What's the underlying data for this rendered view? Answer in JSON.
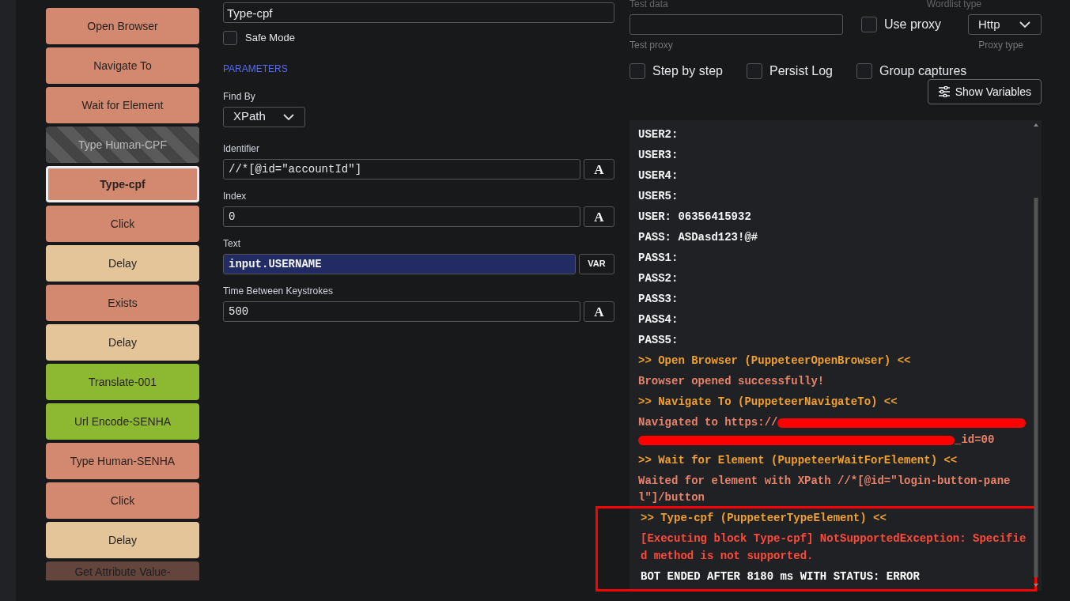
{
  "blocks": [
    {
      "label": "Open Browser",
      "kind": "action",
      "selected": false,
      "disabled": false
    },
    {
      "label": "Navigate To",
      "kind": "action",
      "selected": false,
      "disabled": false
    },
    {
      "label": "Wait for Element",
      "kind": "action",
      "selected": false,
      "disabled": false
    },
    {
      "label": "Type Human-CPF",
      "kind": "action",
      "selected": false,
      "disabled": true
    },
    {
      "label": "Type-cpf",
      "kind": "action",
      "selected": true,
      "disabled": false
    },
    {
      "label": "Click",
      "kind": "action",
      "selected": false,
      "disabled": false
    },
    {
      "label": "Delay",
      "kind": "delay",
      "selected": false,
      "disabled": false
    },
    {
      "label": "Exists",
      "kind": "action",
      "selected": false,
      "disabled": false
    },
    {
      "label": "Delay",
      "kind": "delay",
      "selected": false,
      "disabled": false
    },
    {
      "label": "Translate-001",
      "kind": "function",
      "selected": false,
      "disabled": false
    },
    {
      "label": "Url Encode-SENHA",
      "kind": "function",
      "selected": false,
      "disabled": false
    },
    {
      "label": "Type Human-SENHA",
      "kind": "action",
      "selected": false,
      "disabled": false
    },
    {
      "label": "Click",
      "kind": "action",
      "selected": false,
      "disabled": false
    },
    {
      "label": "Delay",
      "kind": "delay",
      "selected": false,
      "disabled": false
    },
    {
      "label": "Get Attribute Value-",
      "kind": "action",
      "selected": false,
      "disabled": false
    }
  ],
  "block_settings": {
    "name": "Type-cpf",
    "safe_mode": {
      "label": "Safe Mode",
      "checked": false
    },
    "section": "PARAMETERS",
    "find_by": {
      "label": "Find By",
      "value": "XPath"
    },
    "params": [
      {
        "label": "Identifier",
        "value": "//*[@id=\"accountId\"]",
        "mode": "A",
        "kind": "fixed"
      },
      {
        "label": "Index",
        "value": "0",
        "mode": "A",
        "kind": "fixed"
      },
      {
        "label": "Text",
        "value": "input.USERNAME",
        "mode": "VAR",
        "kind": "variable"
      },
      {
        "label": "Time Between Keystrokes",
        "value": "500",
        "mode": "A",
        "kind": "fixed"
      }
    ]
  },
  "debugger": {
    "test_data_label": "Test data",
    "wordlist_type_label": "Wordlist type",
    "test_proxy_label": "Test proxy",
    "use_proxy": {
      "label": "Use proxy",
      "checked": false
    },
    "proxy_type": {
      "value": "Http",
      "label": "Proxy type"
    },
    "options": [
      {
        "label": "Step by step",
        "checked": false
      },
      {
        "label": "Persist Log",
        "checked": false
      },
      {
        "label": "Group captures",
        "checked": false
      }
    ],
    "show_variables": "Show Variables",
    "log": [
      {
        "kind": "variable",
        "text": "USER2:"
      },
      {
        "kind": "variable",
        "text": "USER3:"
      },
      {
        "kind": "variable",
        "text": "USER4:"
      },
      {
        "kind": "variable",
        "text": "USER5:"
      },
      {
        "kind": "variable",
        "text": "USER: 06356415932"
      },
      {
        "kind": "variable",
        "text": "PASS: ASDasd123!@#"
      },
      {
        "kind": "variable",
        "text": "PASS1:"
      },
      {
        "kind": "variable",
        "text": "PASS2:"
      },
      {
        "kind": "variable",
        "text": "PASS3:"
      },
      {
        "kind": "variable",
        "text": "PASS4:"
      },
      {
        "kind": "variable",
        "text": "PASS5:"
      },
      {
        "kind": "header",
        "text": ">> Open Browser (PuppeteerOpenBrowser) <<"
      },
      {
        "kind": "info",
        "text": "Browser opened successfully!"
      },
      {
        "kind": "header",
        "text": ">> Navigate To (PuppeteerNavigateTo) <<"
      },
      {
        "kind": "redacted",
        "text": "Navigated to https://",
        "tail": "_id=00"
      },
      {
        "kind": "header",
        "text": ">> Wait for Element (PuppeteerWaitForElement) <<"
      },
      {
        "kind": "info",
        "text": "Waited for element with XPath //*[@id=\"login-button-panel\"]/button"
      },
      {
        "kind": "header",
        "text": ">> Type-cpf (PuppeteerTypeElement) <<",
        "highlighted": true
      },
      {
        "kind": "error",
        "text": "[Executing block Type-cpf] NotSupportedException: Specified method is not supported.",
        "highlighted": true
      },
      {
        "kind": "end",
        "text": "BOT ENDED AFTER 8180 ms WITH STATUS: ERROR",
        "highlighted": true
      }
    ]
  }
}
